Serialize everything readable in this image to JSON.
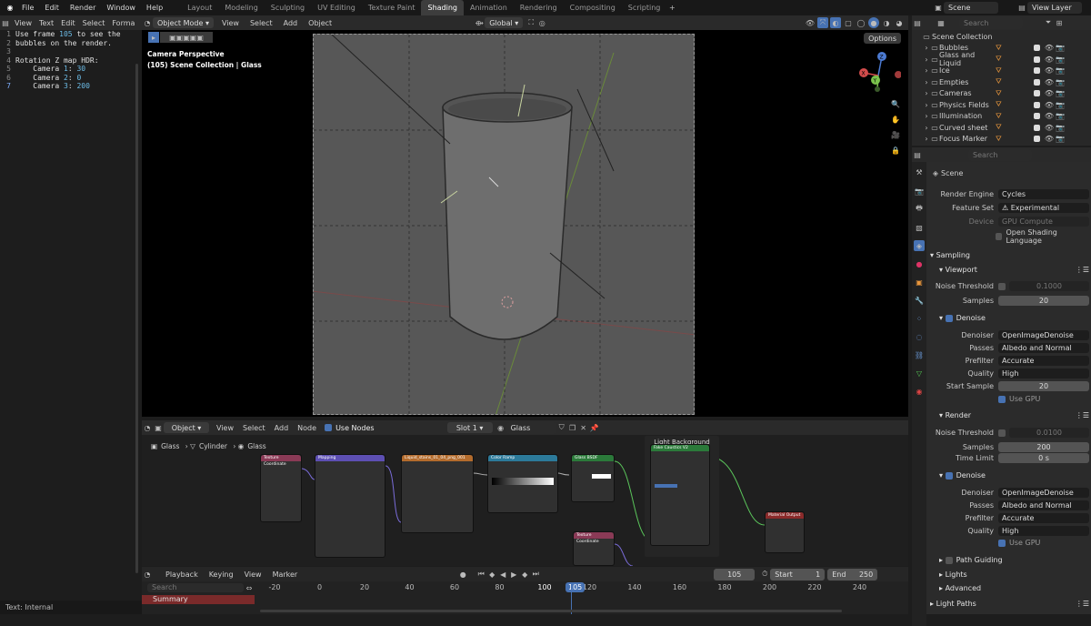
{
  "topbar": {
    "menus": [
      "File",
      "Edit",
      "Render",
      "Window",
      "Help"
    ],
    "workspaces": [
      "Layout",
      "Modeling",
      "Sculpting",
      "UV Editing",
      "Texture Paint",
      "Shading",
      "Animation",
      "Rendering",
      "Compositing",
      "Scripting"
    ],
    "active_workspace": "Shading",
    "scene": "Scene",
    "view_layer": "View Layer"
  },
  "text_editor": {
    "header": [
      "View",
      "Text",
      "Edit",
      "Select",
      "Forma"
    ],
    "lines": [
      {
        "n": "1",
        "t": "Use frame ",
        "num": "105",
        "t2": " to see the"
      },
      {
        "n": "2",
        "t": "bubbles on the render.",
        "num": "",
        "t2": ""
      },
      {
        "n": "3",
        "t": "",
        "num": "",
        "t2": ""
      },
      {
        "n": "4",
        "t": "Rotation Z map HDR:",
        "num": "",
        "t2": ""
      },
      {
        "n": "5",
        "t": "    Camera ",
        "num": "1",
        "t2": ": ",
        "num2": "30"
      },
      {
        "n": "6",
        "t": "    Camera ",
        "num": "2",
        "t2": ": ",
        "num2": "0"
      },
      {
        "n": "7",
        "t": "    Camera ",
        "num": "3",
        "t2": ": ",
        "num2": "200"
      }
    ]
  },
  "viewport": {
    "mode": "Object Mode",
    "header": [
      "View",
      "Select",
      "Add",
      "Object"
    ],
    "orientation": "Global",
    "camera_label": "Camera Perspective",
    "collection_label": "(105) Scene Collection | Glass",
    "options": "Options"
  },
  "outliner": {
    "search": "Search",
    "root": "Scene Collection",
    "items": [
      "Bubbles",
      "Glass and Liquid",
      "Ice",
      "Empties",
      "Cameras",
      "Physics Fields",
      "Illumination",
      "Curved sheet",
      "Focus Marker"
    ]
  },
  "properties": {
    "search": "Search",
    "scene_name": "Scene",
    "render_engine_label": "Render Engine",
    "render_engine": "Cycles",
    "feature_set_label": "Feature Set",
    "feature_set": "Experimental",
    "device_label": "Device",
    "device": "GPU Compute",
    "osl": "Open Shading Language",
    "sampling": "Sampling",
    "viewport": "Viewport",
    "noise_threshold_label": "Noise Threshold",
    "vp_noise": "0.1000",
    "samples_label": "Samples",
    "vp_samples": "20",
    "denoise": "Denoise",
    "denoiser_label": "Denoiser",
    "denoiser": "OpenImageDenoise",
    "passes_label": "Passes",
    "passes": "Albedo and Normal",
    "prefilter_label": "Prefilter",
    "prefilter": "Accurate",
    "quality_label": "Quality",
    "quality": "High",
    "start_sample_label": "Start Sample",
    "start_sample": "20",
    "use_gpu": "Use GPU",
    "render": "Render",
    "r_noise": "0.0100",
    "r_samples": "200",
    "time_limit_label": "Time Limit",
    "time_limit": "0 s",
    "path_guiding": "Path Guiding",
    "lights": "Lights",
    "advanced": "Advanced",
    "light_paths": "Light Paths"
  },
  "node_editor": {
    "type": "Object",
    "header": [
      "View",
      "Select",
      "Add",
      "Node"
    ],
    "use_nodes": "Use Nodes",
    "slot": "Slot 1",
    "material": "Glass",
    "breadcrumb": [
      "Glass",
      "Cylinder",
      "Glass"
    ],
    "frame_label": "Light Background",
    "nodes": [
      "Texture Coordinate",
      "Mapping",
      "Liquid_stains_01_04_png_001",
      "Color Ramp",
      "Glass BSDF",
      "Fake Caustics V2",
      "Material Output",
      "Texture Coordinate"
    ]
  },
  "timeline": {
    "menus": [
      "Playback",
      "Keying",
      "View",
      "Marker"
    ],
    "current_frame": "105",
    "start_label": "Start",
    "start": "1",
    "end_label": "End",
    "end": "250",
    "summary": "Summary",
    "search": "Search",
    "ticks": [
      "-20",
      "0",
      "20",
      "40",
      "60",
      "80",
      "100",
      "120",
      "140",
      "160",
      "180",
      "200",
      "220",
      "240"
    ]
  },
  "status": "Text: Internal"
}
